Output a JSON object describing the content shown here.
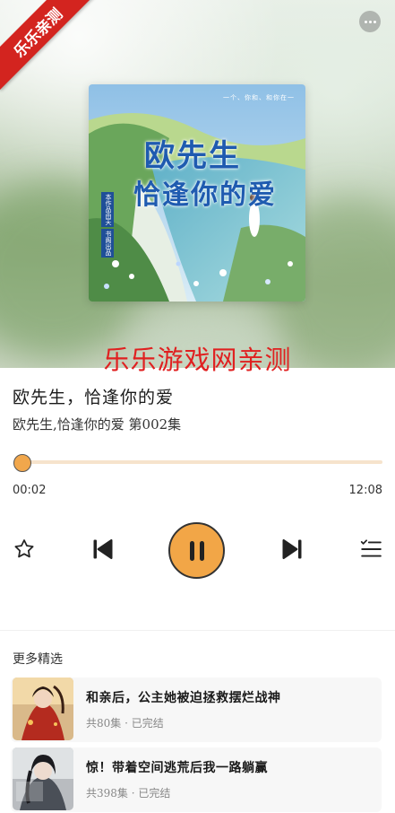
{
  "watermark_corner": "乐乐亲测",
  "watermark_center": "乐乐游戏网亲测",
  "cover": {
    "title_line1": "欧先生",
    "title_line2": "恰逢你的爱",
    "tagline": "一个、你和、和你在一",
    "side_labels": [
      "本作品由天",
      "书阁出品"
    ]
  },
  "track": {
    "title": "欧先生，恰逢你的爱",
    "subtitle": "欧先生,恰逢你的爱 第002集",
    "current_time": "00:02",
    "total_time": "12:08",
    "progress": 0.003
  },
  "controls": {
    "favorite_icon": "star-outline-icon",
    "prev_icon": "skip-previous-icon",
    "play_icon": "pause-icon",
    "next_icon": "skip-next-icon",
    "list_icon": "playlist-icon"
  },
  "more_section": {
    "title": "更多精选",
    "items": [
      {
        "title": "和亲后，公主她被迫拯救摆烂战神",
        "episodes": "共80集",
        "status": "已完结"
      },
      {
        "title": "惊！带着空间逃荒后我一路躺赢",
        "episodes": "共398集",
        "status": "已完结"
      }
    ]
  },
  "colors": {
    "accent": "#f2a647",
    "progress_track": "#f6e3cc",
    "watermark_red": "#e02020"
  }
}
